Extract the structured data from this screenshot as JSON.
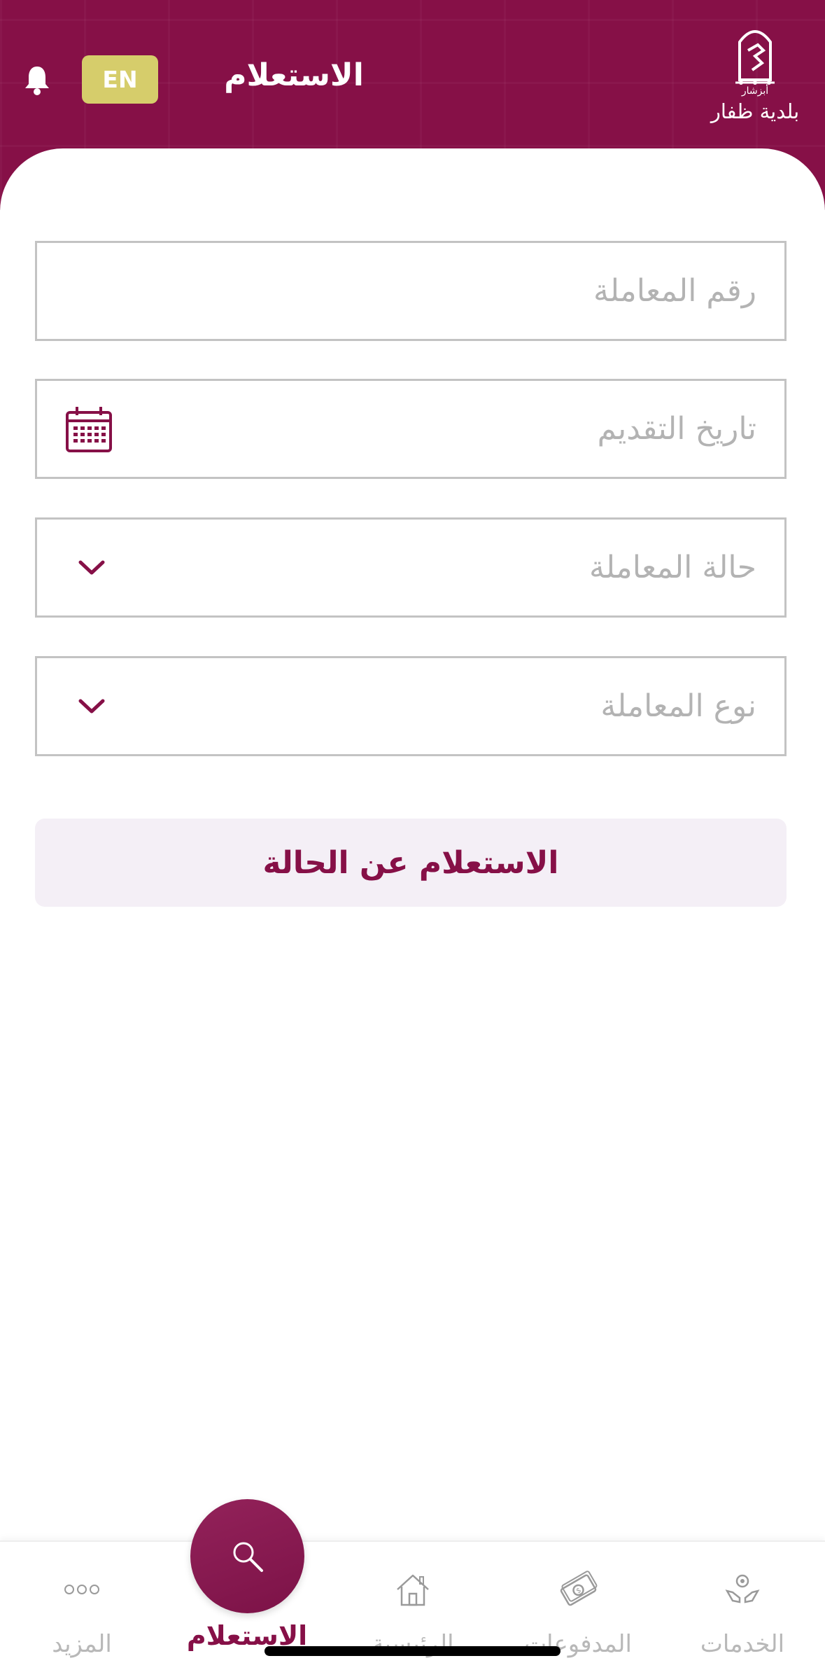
{
  "header": {
    "title": "الاستعلام",
    "language_button": "EN",
    "logo_text": "بلدية ظفار",
    "logo_small_text": "أبزشار",
    "bell_icon": "bell-icon",
    "brand_color": "#861047"
  },
  "form": {
    "transaction_number_placeholder": "رقم المعاملة",
    "submission_date_placeholder": "تاريخ التقديم",
    "transaction_status_placeholder": "حالة المعاملة",
    "transaction_type_placeholder": "نوع المعاملة",
    "submit_label": "الاستعلام عن الحالة",
    "calendar_icon": "calendar-icon",
    "chevron_icon": "chevron-down-icon"
  },
  "tabbar": {
    "items": [
      {
        "label": "الخدمات",
        "icon": "services-icon"
      },
      {
        "label": "المدفوعات",
        "icon": "payments-icon"
      },
      {
        "label": "الرئيسية",
        "icon": "home-icon"
      },
      {
        "label": "الاستعلام",
        "icon": "search-icon",
        "active": true
      },
      {
        "label": "المزيد",
        "icon": "more-icon"
      }
    ]
  }
}
